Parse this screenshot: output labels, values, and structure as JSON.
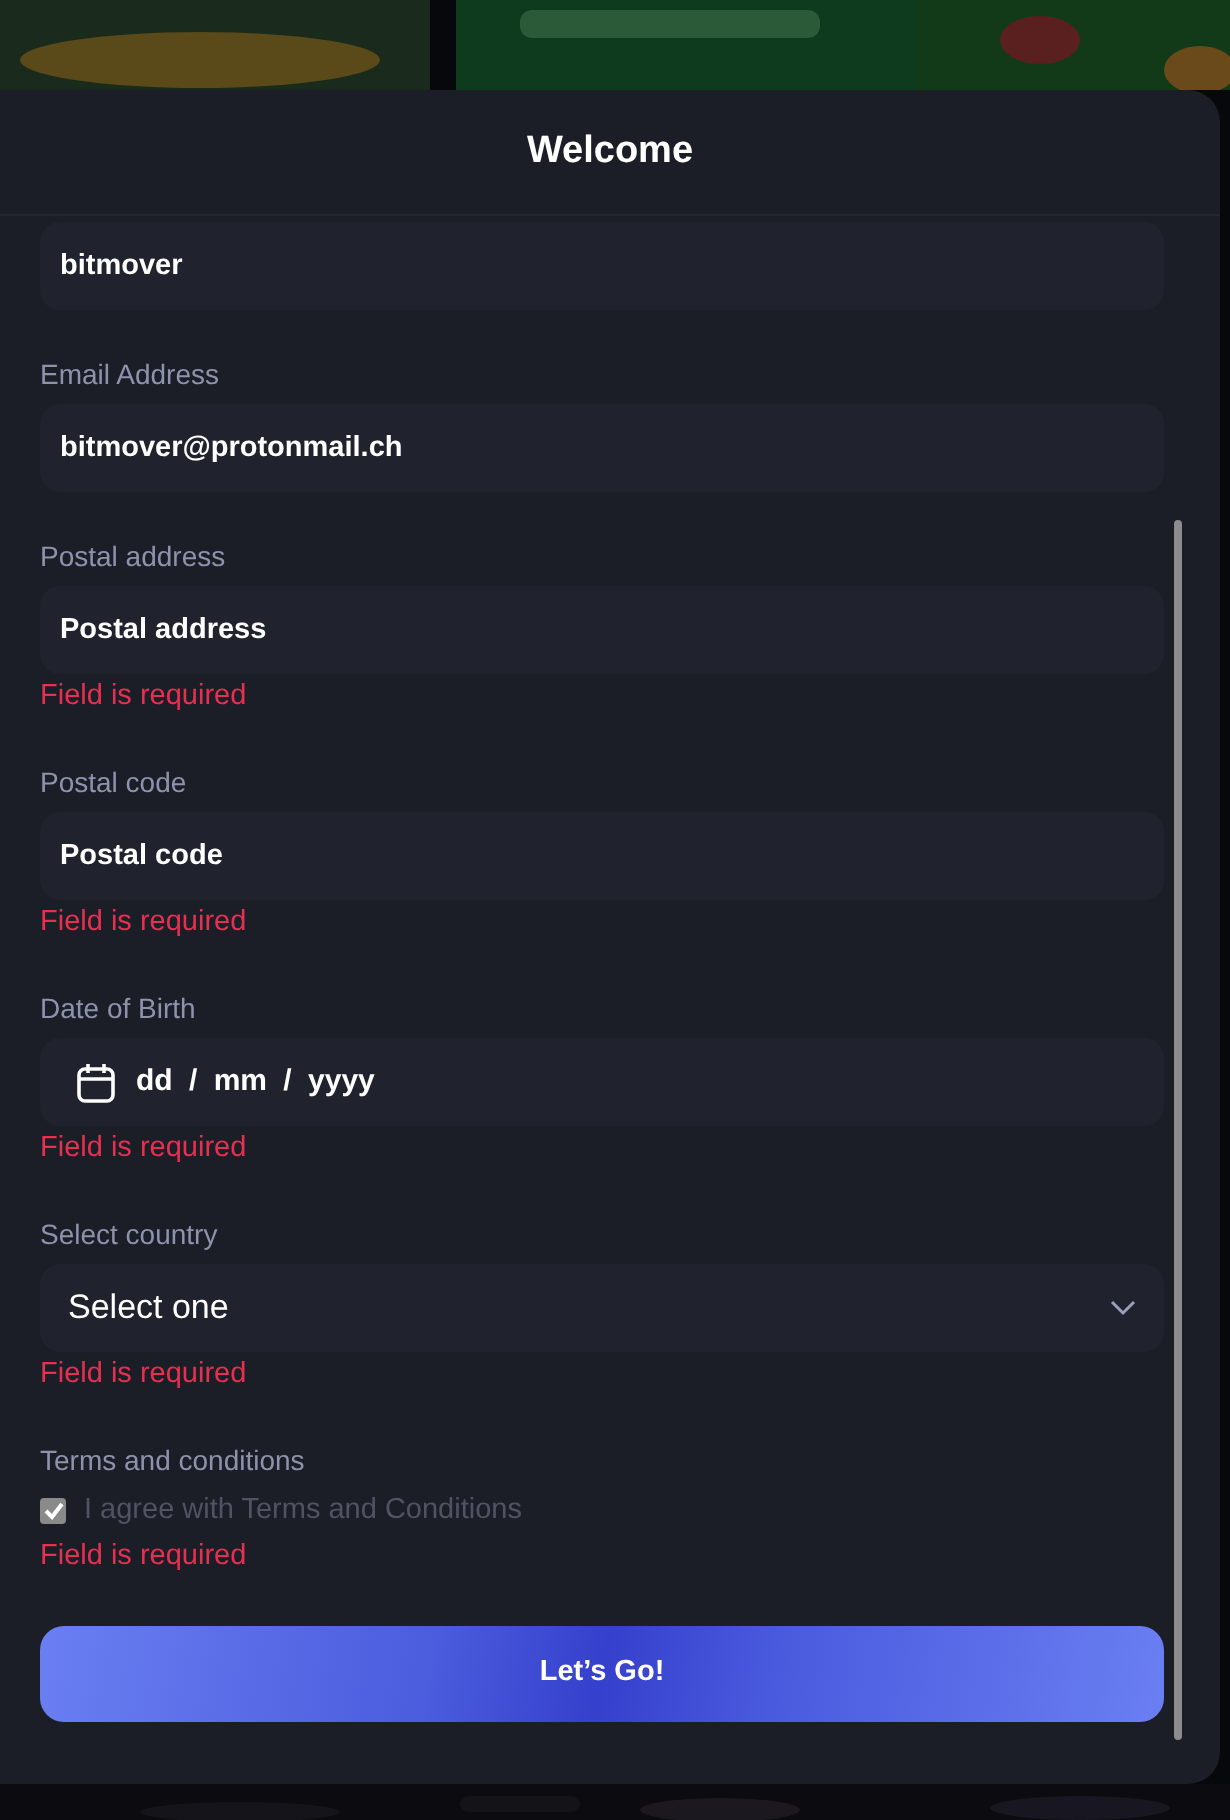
{
  "dialog": {
    "title": "Welcome"
  },
  "fields": [
    {
      "kind": "text",
      "value": "bitmover"
    },
    {
      "kind": "text",
      "label": "Email Address",
      "value": "bitmover@protonmail.ch"
    },
    {
      "kind": "text",
      "label": "Postal address",
      "placeholder": "Postal address",
      "error": "Field is required"
    },
    {
      "kind": "text",
      "label": "Postal code",
      "placeholder": "Postal code",
      "error": "Field is required"
    },
    {
      "kind": "date",
      "label": "Date of Birth",
      "placeholder": "dd / mm / yyyy",
      "error": "Field is required"
    },
    {
      "kind": "select",
      "label": "Select country",
      "value": "Select one",
      "error": "Field is required"
    },
    {
      "kind": "checkbox",
      "label": "Terms and conditions",
      "option": "I agree with Terms and Conditions",
      "checked": true,
      "disabled": true,
      "error": "Field is required"
    }
  ],
  "submit_button": "Let’s Go!"
}
